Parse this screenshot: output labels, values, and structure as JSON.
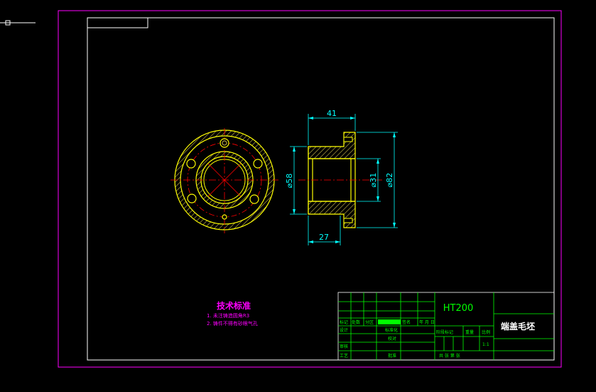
{
  "colors": {
    "background": "#000000",
    "sheet_border": "#ff00ff",
    "frame": "#ffffff",
    "outline": "#ffff00",
    "hatch": "#b5a642",
    "dimension": "#00ffff",
    "centerline": "#ff0000",
    "hidden": "#ffff00",
    "title_block": "#00ff00",
    "notes": "#ff00ff",
    "fill_bar": "#00ff00"
  },
  "dimensions": {
    "width_overall": "41",
    "width_inner": "27",
    "dia_inner_bore": "⌀58",
    "dia_small": "⌀31",
    "dia_outer": "⌀82"
  },
  "notes": {
    "heading": "技术标准",
    "line1": "1. 未注铸造圆角R3",
    "line2": "2. 铸件不得有砂眼气孔"
  },
  "title_block": {
    "material": "HT200",
    "part_name": "端盖毛坯",
    "scale": "1:1",
    "labels": {
      "mark": "标记",
      "count": "处数",
      "zone": "分区",
      "doc_no": "更改文件号",
      "sign": "签名",
      "date": "年 月 日",
      "design": "设计",
      "standardize": "标准化",
      "review": "审核",
      "process": "工艺",
      "approve": "批准",
      "proofread": "校对",
      "stage_mark": "阶段标记",
      "weight": "重量",
      "scale_label": "比例",
      "sheets_total": "共 张 第 张"
    }
  }
}
